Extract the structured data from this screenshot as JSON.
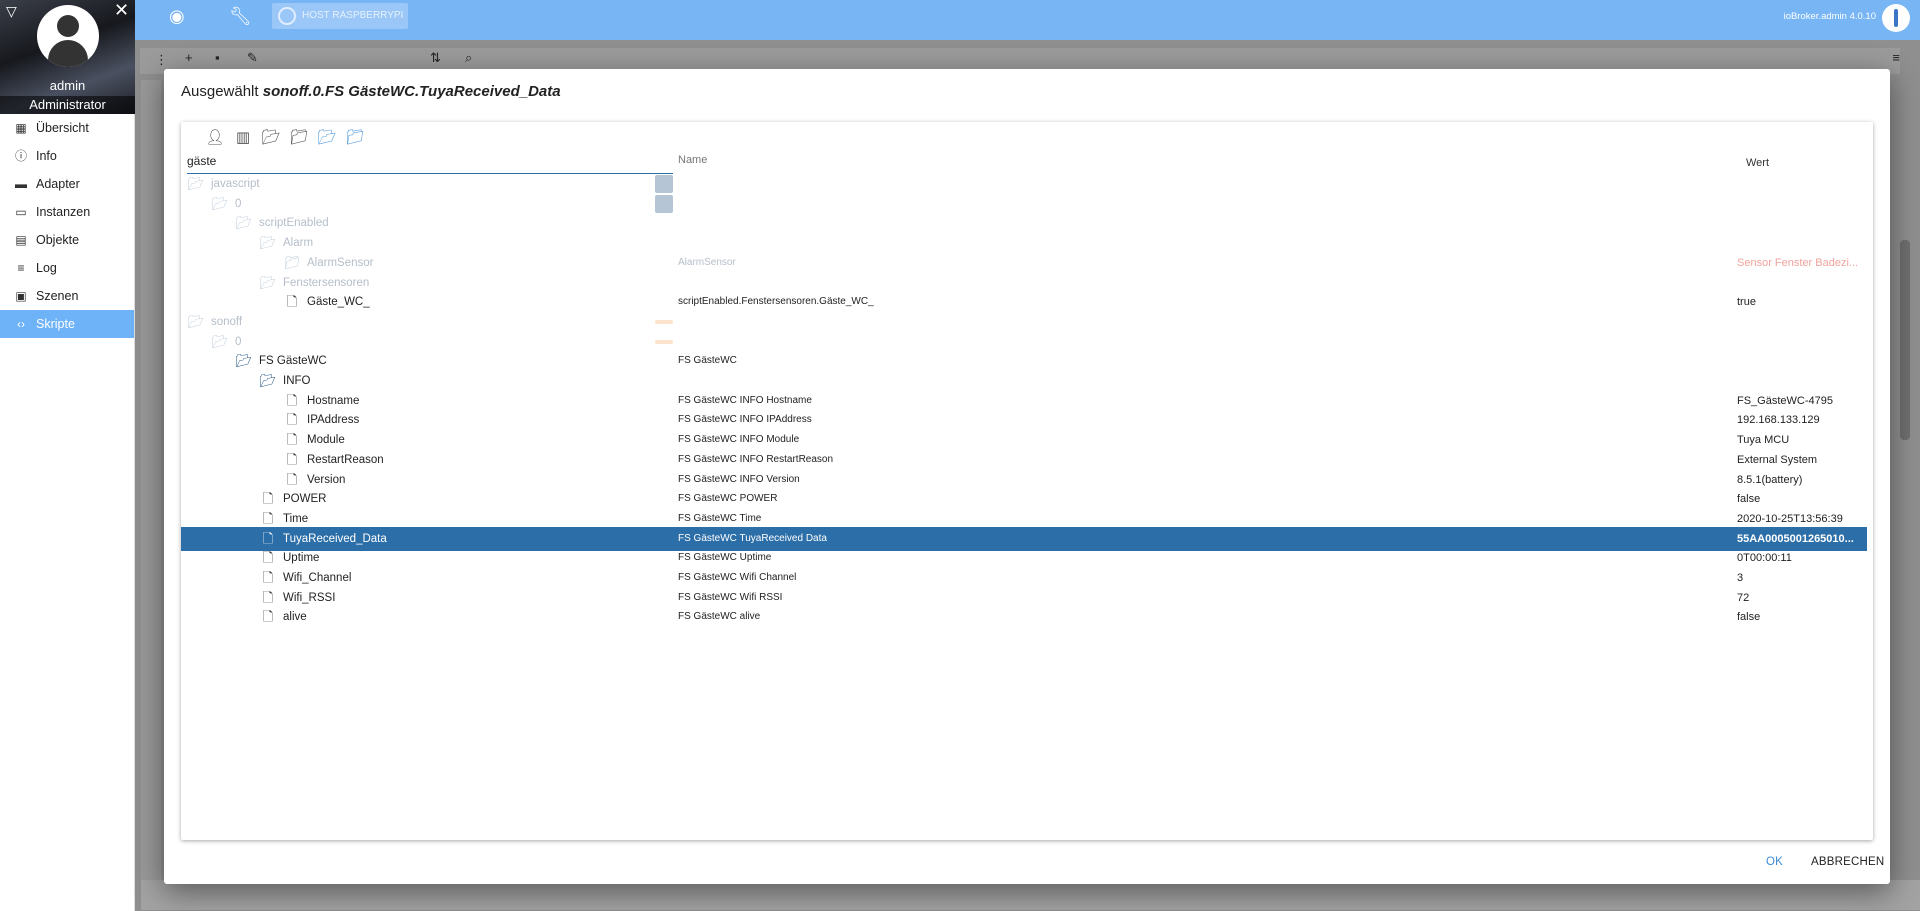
{
  "sidebar": {
    "user_name": "admin",
    "user_role": "Administrator",
    "items": [
      {
        "label": "Übersicht",
        "icon": "grid-icon"
      },
      {
        "label": "Info",
        "icon": "info-icon"
      },
      {
        "label": "Adapter",
        "icon": "adapter-icon"
      },
      {
        "label": "Instanzen",
        "icon": "instances-icon"
      },
      {
        "label": "Objekte",
        "icon": "objects-icon"
      },
      {
        "label": "Log",
        "icon": "log-icon"
      },
      {
        "label": "Szenen",
        "icon": "scenes-icon"
      },
      {
        "label": "Skripte",
        "icon": "code-icon",
        "active": true
      }
    ]
  },
  "topbar": {
    "host_label": "HOST RASPBERRYPI",
    "version": "ioBroker.admin 4.0.10",
    "accent_color": "#78b5f5"
  },
  "dialog": {
    "title_prefix": "Ausgewählt",
    "title_selected": "sonoff.0.FS GästeWC.TuyaReceived_Data",
    "filter_value": "gäste",
    "col_name": "Name",
    "col_value": "Wert",
    "ok_label": "OK",
    "cancel_label": "ABBRECHEN"
  },
  "tree": [
    {
      "id": "javascript",
      "name": "",
      "value": "",
      "type": "folder-open",
      "faded": true,
      "badge": "js"
    },
    {
      "id": "0",
      "name": "",
      "value": "",
      "type": "folder-open",
      "faded": true,
      "badge": "js"
    },
    {
      "id": "scriptEnabled",
      "name": "",
      "value": "",
      "type": "folder-open",
      "faded": true
    },
    {
      "id": "Alarm",
      "name": "",
      "value": "",
      "type": "folder-open",
      "faded": true
    },
    {
      "id": "AlarmSensor",
      "name": "AlarmSensor",
      "value": "Sensor Fenster Badezi...",
      "type": "folder",
      "faded": true
    },
    {
      "id": "Fenstersensoren",
      "name": "",
      "value": "",
      "type": "folder-open",
      "faded": true
    },
    {
      "id": "Gäste_WC_",
      "name": "scriptEnabled.Fenstersensoren.Gäste_WC_",
      "value": "true",
      "type": "file"
    },
    {
      "id": "sonoff",
      "name": "",
      "value": "",
      "type": "folder-open",
      "faded": true,
      "badge": "sonoff"
    },
    {
      "id": "0",
      "name": "",
      "value": "",
      "type": "folder-open",
      "faded": true,
      "badge": "sonoff"
    },
    {
      "id": "FS GästeWC",
      "name": "FS GästeWC",
      "value": "",
      "type": "folder-open-dark"
    },
    {
      "id": "INFO",
      "name": "",
      "value": "",
      "type": "folder-open-dark"
    },
    {
      "id": "Hostname",
      "name": "FS GästeWC INFO Hostname",
      "value": "FS_GästeWC-4795",
      "type": "file"
    },
    {
      "id": "IPAddress",
      "name": "FS GästeWC INFO IPAddress",
      "value": "192.168.133.129",
      "type": "file"
    },
    {
      "id": "Module",
      "name": "FS GästeWC INFO Module",
      "value": "Tuya MCU",
      "type": "file"
    },
    {
      "id": "RestartReason",
      "name": "FS GästeWC INFO RestartReason",
      "value": "External System",
      "type": "file"
    },
    {
      "id": "Version",
      "name": "FS GästeWC INFO Version",
      "value": "8.5.1(battery)",
      "type": "file"
    },
    {
      "id": "POWER",
      "name": "FS GästeWC POWER",
      "value": "false",
      "type": "file"
    },
    {
      "id": "Time",
      "name": "FS GästeWC Time",
      "value": "2020-10-25T13:56:39",
      "type": "file"
    },
    {
      "id": "TuyaReceived_Data",
      "name": "FS GästeWC TuyaReceived Data",
      "value": "55AA0005001265010...",
      "type": "file",
      "selected": true
    },
    {
      "id": "Uptime",
      "name": "FS GästeWC Uptime",
      "value": "0T00:00:11",
      "type": "file"
    },
    {
      "id": "Wifi_Channel",
      "name": "FS GästeWC Wifi Channel",
      "value": "3",
      "type": "file"
    },
    {
      "id": "Wifi_RSSI",
      "name": "FS GästeWC Wifi RSSI",
      "value": "72",
      "type": "file"
    },
    {
      "id": "alive",
      "name": "FS GästeWC alive",
      "value": "false",
      "type": "file"
    }
  ]
}
